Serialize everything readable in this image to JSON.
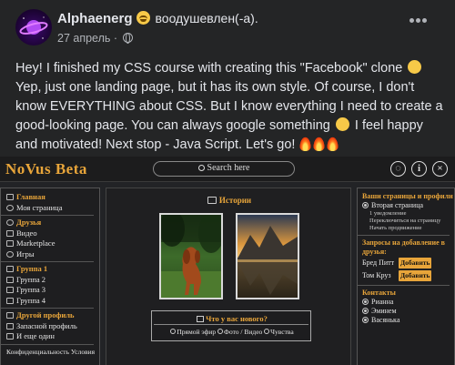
{
  "post": {
    "author": "Alphaenerg",
    "feeling": "воодушевлен(-а).",
    "date": "27 апрель ·",
    "text_line1": "Hey! I finished my CSS course with creating this \"Facebook\" clone",
    "text_rest": "Yep, just one landing page, but it has its own style. Of course, I don't know EVERYTHING about CSS. But I know everything I need to create a good-looking page. You can always google something",
    "text_end": "I feel happy and motivated! Next stop - Java Script. Let's go!"
  },
  "site": {
    "logo": "NoVus Beta",
    "search_placeholder": "Search here",
    "icon_chat": "◌",
    "icon_info": "i",
    "icon_close": "×"
  },
  "left_nav": {
    "main_head": "Главная",
    "my_page": "Моя страница",
    "friends_head": "Друзья",
    "video": "Видео",
    "marketplace": "Marketplace",
    "games": "Игры",
    "group1_head": "Группа 1",
    "group2": "Группа 2",
    "group3": "Группа 3",
    "group4": "Группа 4",
    "other_head": "Другой профиль",
    "backup_profile": "Запасной профиль",
    "another": "И еще один",
    "footer": "Конфиденциальность Условия"
  },
  "center": {
    "stories_title": "Истории",
    "whats_new": "Что у вас нового?",
    "live": "Прямой эфир",
    "photo": "Фото / Видео",
    "feelings": "Чувства"
  },
  "right": {
    "pages_head": "Ваши страницы и профили",
    "second_page": "Вторая страница",
    "notification": "1 уведомление",
    "switch_page": "Переключиться на страницу",
    "start_promo": "Начать продвижение",
    "requests_head": "Запросы на добавление в друзья:",
    "req1": "Бред Питт",
    "req2": "Том Круз",
    "add_label": "Добавить",
    "contacts_head": "Контакты",
    "contact1": "Рианна",
    "contact2": "Эминем",
    "contact3": "Васянька"
  }
}
